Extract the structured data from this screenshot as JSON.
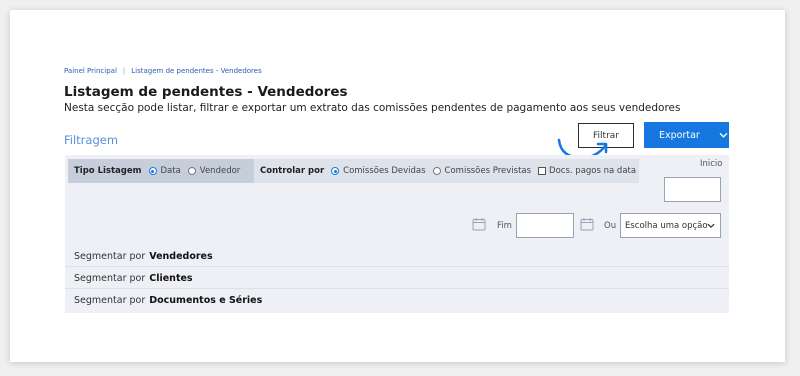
{
  "breadcrumb": {
    "items": [
      "Painel Principal",
      "Listagem de pendentes - Vendedores"
    ],
    "separator": "|"
  },
  "page": {
    "title": "Listagem de pendentes - Vendedores",
    "description": "Nesta secção pode listar, filtrar e exportar um extrato das comissões pendentes de pagamento aos seus vendedores"
  },
  "filter_section": {
    "title": "Filtragem",
    "filter_button": "Filtrar",
    "export_button": "Exportar"
  },
  "toolbar": {
    "tipo_listagem_label": "Tipo Listagem",
    "tipo_options": [
      {
        "label": "Data",
        "selected": true
      },
      {
        "label": "Vendedor",
        "selected": false
      }
    ],
    "controlar_label": "Controlar por",
    "controlar_options": [
      {
        "label": "Comissões Devidas",
        "selected": true
      },
      {
        "label": "Comissões Previstas",
        "selected": false
      }
    ],
    "docs_checkbox": {
      "label": "Docs. pagos na data",
      "checked": false
    }
  },
  "date_range": {
    "inicio_label": "Inicio",
    "inicio_value": "",
    "fim_label": "Fim",
    "fim_value": "",
    "ou_label": "Ou",
    "select_value": "Escolha uma opção"
  },
  "segments": [
    {
      "prefix": "Segmentar por",
      "target": "Vendedores"
    },
    {
      "prefix": "Segmentar por",
      "target": "Clientes"
    },
    {
      "prefix": "Segmentar por",
      "target": "Documentos e Séries"
    }
  ],
  "colors": {
    "accent": "#1677e0",
    "section_title": "#5b8fd6",
    "panel_bg": "#eef0f5"
  }
}
